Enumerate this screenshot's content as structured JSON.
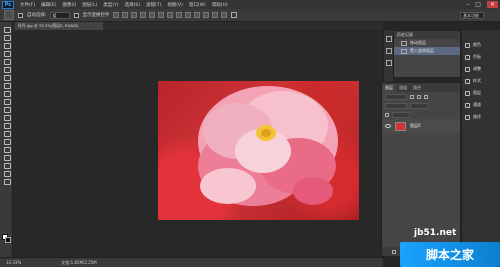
{
  "app": {
    "logo": "Ps"
  },
  "menu": [
    "文件(F)",
    "编辑(E)",
    "图像(I)",
    "图层(L)",
    "类型(Y)",
    "选择(S)",
    "滤镜(T)",
    "视图(V)",
    "窗口(W)",
    "帮助(H)"
  ],
  "window_controls": {
    "minimize": "–",
    "maximize": "□",
    "close": "×"
  },
  "options": {
    "auto_select_label": "自动选择:",
    "auto_select_value": "组",
    "transform_label": "显示变换控件"
  },
  "workspace": "基本功能",
  "document": {
    "tab": "牡丹.jpg @ 33.3%(图层0, RGB/8)"
  },
  "status": {
    "zoom": "33.33%",
    "doc_size": "文档:1.85M/2.25M"
  },
  "history": {
    "tab": "历史记录",
    "items": [
      "移动图层",
      "置入变换图层"
    ]
  },
  "layers": {
    "tabs": [
      "图层",
      "通道",
      "路径"
    ],
    "layer_name": "图层0"
  },
  "right_panel": {
    "items": [
      "颜色",
      "色板",
      "调整",
      "样式",
      "图层",
      "通道",
      "路径"
    ]
  },
  "watermark": {
    "url": "jb51.net",
    "logo_text": "脚本之家"
  },
  "colors": {
    "photo": "#d23538",
    "accent": "#1aa3ff"
  }
}
